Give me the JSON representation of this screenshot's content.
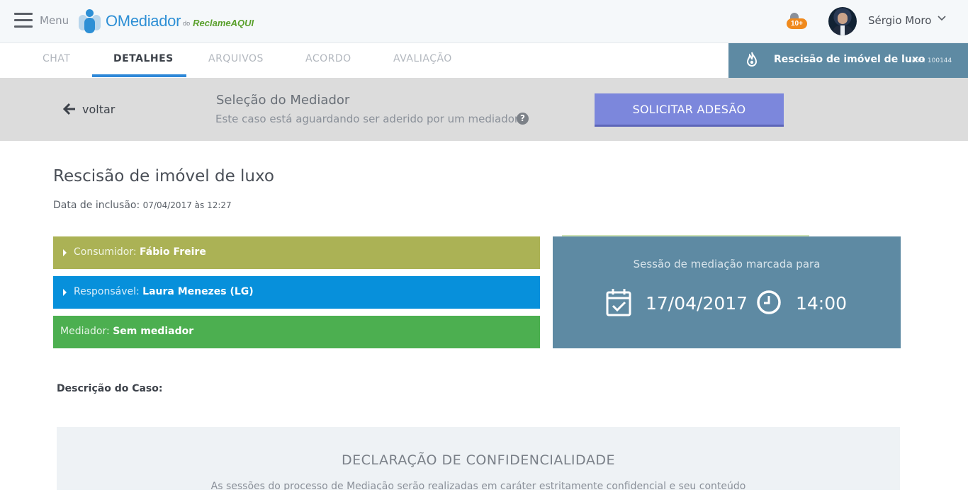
{
  "header": {
    "menu_label": "Menu",
    "logo": {
      "name": "OMediador",
      "do": "do",
      "brand": "ReclameAQUI"
    },
    "notifications": {
      "count": "10+",
      "icon": "bell-icon",
      "badge_color": "#f08a1d"
    },
    "user": {
      "name": "Sérgio Moro"
    }
  },
  "tabs": [
    {
      "label": "CHAT",
      "active": false
    },
    {
      "label": "DETALHES",
      "active": true
    },
    {
      "label": "ARQUIVOS",
      "active": false
    },
    {
      "label": "ACORDO",
      "active": false
    },
    {
      "label": "AVALIAÇÃO",
      "active": false
    }
  ],
  "case_tag": {
    "title": "Rescisão de imóvel de luxo",
    "code": "cód. 100144",
    "icon": "flame-icon"
  },
  "subbar": {
    "back_label": "voltar",
    "title": "Seleção do Mediador",
    "subtitle": "Este caso está aguardando ser aderido por um mediador",
    "help_icon": "?",
    "action_label": "SOLICITAR ADESÃO"
  },
  "case": {
    "title": "Rescisão de imóvel de luxo",
    "inclusion_label": "Data de inclusão:",
    "inclusion_value": "07/04/2017 às 12:27"
  },
  "parties": {
    "consumer": {
      "label": "Consumidor:",
      "value": "Fábio Freire",
      "color": "#abb255"
    },
    "responsible": {
      "label": "Responsável:",
      "value": "Laura Menezes (LG)",
      "color": "#0790db"
    },
    "mediator": {
      "label": "Mediador:",
      "value": "Sem mediador",
      "color": "#4caf50"
    }
  },
  "session": {
    "title": "Sessão de mediação marcada para",
    "date": "17/04/2017",
    "time": "14:00",
    "color": "#5e8aa3"
  },
  "description": {
    "label": "Descrição do Caso:"
  },
  "confidentiality": {
    "title": "DECLARAÇÃO DE CONFIDENCIALIDADE",
    "text": "As sessões do processo de Mediação serão realizadas em caráter estritamente confidencial e seu conteúdo"
  }
}
